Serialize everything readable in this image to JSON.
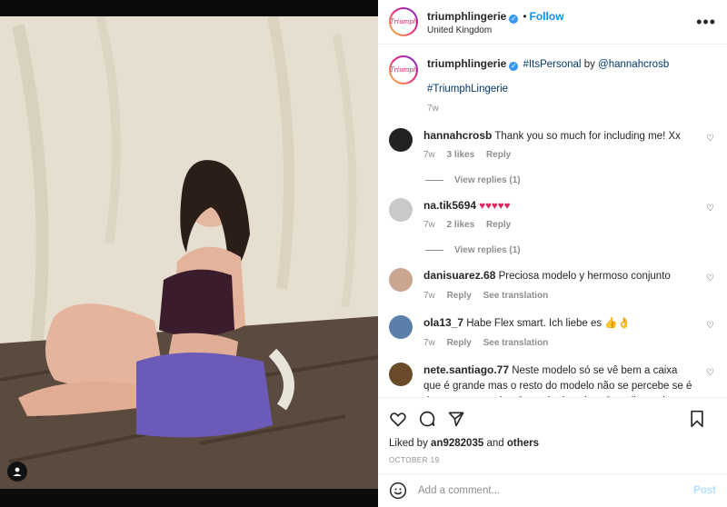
{
  "post": {
    "username": "triumphlingerie",
    "follow_label": "Follow",
    "location": "United Kingdom",
    "more_label": "•••",
    "avatar_text": "Triumph"
  },
  "caption": {
    "username": "triumphlingerie",
    "hashtag1": "#ItsPersonal",
    "by_word": "by",
    "mention": "@hannahcrosb",
    "hashtag2": "#TriumphLingerie",
    "time": "7w"
  },
  "comments": [
    {
      "username": "hannahcrosb",
      "text": "Thank you so much for including me! Xx",
      "time": "7w",
      "likes": "3 likes",
      "reply": "Reply",
      "replies": "View replies (1)",
      "avatar_color": "#222222"
    },
    {
      "username": "na.tik5694",
      "text": "♥♥♥♥♥",
      "time": "7w",
      "likes": "2 likes",
      "reply": "Reply",
      "replies": "View replies (1)",
      "avatar_color": "#c9c9c9"
    },
    {
      "username": "danisuarez.68",
      "text": "Preciosa modelo y hermoso conjunto",
      "time": "7w",
      "reply": "Reply",
      "translate": "See translation",
      "avatar_color": "#caa58f"
    },
    {
      "username": "ola13_7",
      "text": "Habe Flex smart. Ich liebe es 👍👌",
      "time": "7w",
      "reply": "Reply",
      "translate": "See translation",
      "avatar_color": "#5a7fa8"
    },
    {
      "username": "nete.santiago.77",
      "text": "Neste modelo só se vê bem a caixa que é grande mas o resto do modelo não se percebe se é de costas e se alta. Gostaria de saber. Seu cliente desse mesmo",
      "avatar_color": "#6b4a2a"
    }
  ],
  "actions": {
    "liked_by_prefix": "Liked by",
    "liked_by_user": "an9282035",
    "and_word": "and",
    "others": "others",
    "date": "OCTOBER 19"
  },
  "comment_box": {
    "placeholder": "Add a comment...",
    "post_label": "Post"
  }
}
